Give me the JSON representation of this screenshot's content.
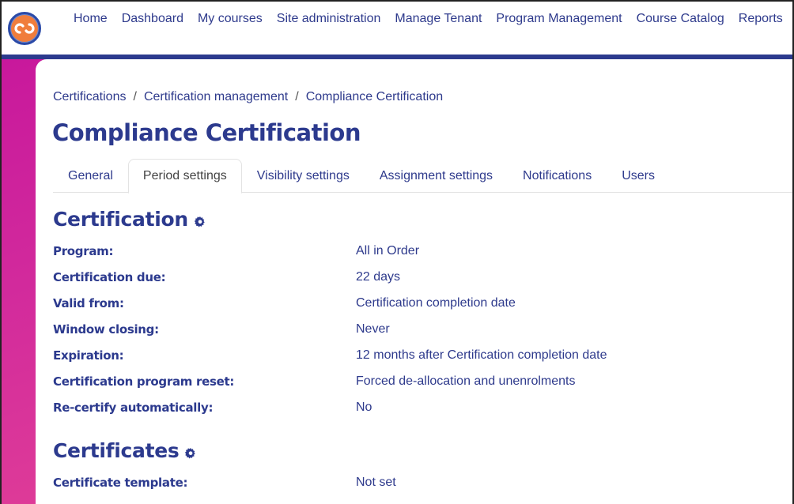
{
  "brand": {
    "logo_icon": "infinity-logo-icon",
    "accent": "#2c3a8e",
    "logo_color": "#f07d3c"
  },
  "nav": {
    "items": [
      {
        "label": "Home"
      },
      {
        "label": "Dashboard"
      },
      {
        "label": "My courses"
      },
      {
        "label": "Site administration"
      },
      {
        "label": "Manage Tenant"
      },
      {
        "label": "Program Management"
      },
      {
        "label": "Course Catalog"
      },
      {
        "label": "Reports"
      }
    ]
  },
  "breadcrumb": {
    "items": [
      {
        "label": "Certifications"
      },
      {
        "label": "Certification management"
      },
      {
        "label": "Compliance Certification"
      }
    ],
    "separator": "/"
  },
  "page": {
    "title": "Compliance Certification"
  },
  "tabs": [
    {
      "label": "General",
      "active": false
    },
    {
      "label": "Period settings",
      "active": true
    },
    {
      "label": "Visibility settings",
      "active": false
    },
    {
      "label": "Assignment settings",
      "active": false
    },
    {
      "label": "Notifications",
      "active": false
    },
    {
      "label": "Users",
      "active": false
    }
  ],
  "sections": {
    "certification": {
      "title": "Certification",
      "icon": "gear-icon",
      "fields": [
        {
          "label": "Program:",
          "value": "All in Order"
        },
        {
          "label": "Certification due:",
          "value": "22 days"
        },
        {
          "label": "Valid from:",
          "value": "Certification completion date"
        },
        {
          "label": "Window closing:",
          "value": "Never"
        },
        {
          "label": "Expiration:",
          "value": "12 months after Certification completion date"
        },
        {
          "label": "Certification program reset:",
          "value": "Forced de-allocation and unenrolments"
        },
        {
          "label": "Re-certify automatically:",
          "value": "No"
        }
      ]
    },
    "certificates": {
      "title": "Certificates",
      "icon": "gear-icon",
      "fields": [
        {
          "label": "Certificate template:",
          "value": "Not set"
        }
      ]
    }
  }
}
